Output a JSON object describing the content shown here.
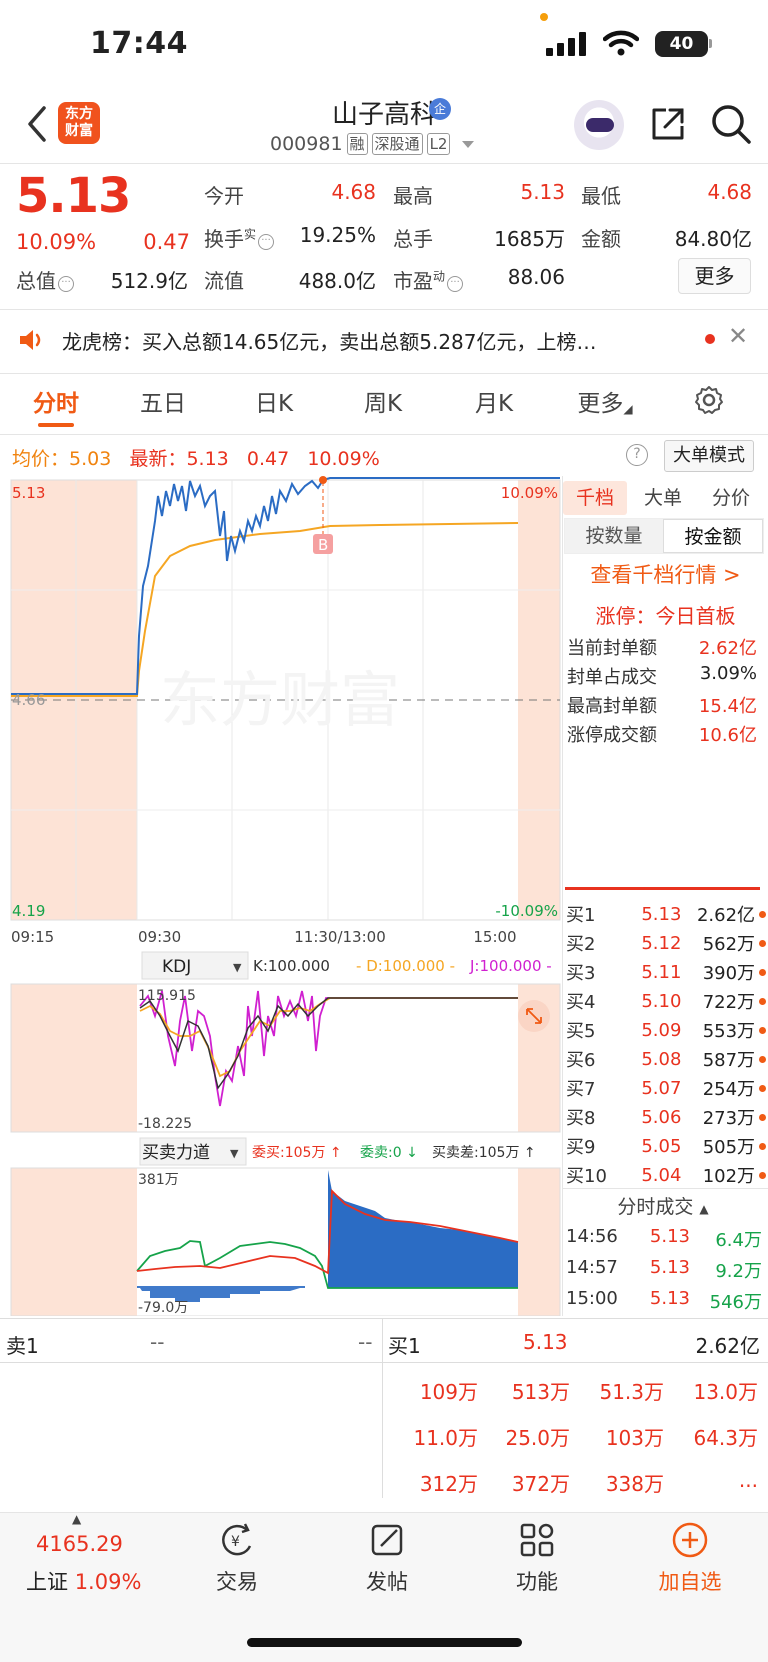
{
  "status": {
    "time": "17:44",
    "battery": "40"
  },
  "header": {
    "logo_text": "东方\n财富",
    "stock_name": "山子高科",
    "name_badge": "企",
    "code": "000981",
    "tags": [
      "融",
      "深股通",
      "L2"
    ]
  },
  "quote": {
    "price": "5.13",
    "pct": "10.09%",
    "change": "0.47",
    "fields": {
      "open_label": "今开",
      "open": "4.68",
      "high_label": "最高",
      "high": "5.13",
      "low_label": "最低",
      "low": "4.68",
      "turnover_label": "换手",
      "turnover_sup": "实",
      "turnover": "19.25%",
      "volume_label": "总手",
      "volume": "1685万",
      "amount_label": "金额",
      "amount": "84.80亿",
      "mktcap_label": "总值",
      "mktcap": "512.9亿",
      "float_label": "流值",
      "float": "488.0亿",
      "pe_label": "市盈",
      "pe_sup": "动",
      "pe": "88.06"
    },
    "more_label": "更多"
  },
  "dragon_tiger": {
    "text": "龙虎榜：买入总额14.65亿元，卖出总额5.287亿元，上榜…"
  },
  "period_tabs": [
    "分时",
    "五日",
    "日K",
    "周K",
    "月K",
    "更多"
  ],
  "info_line": {
    "avg_label": "均价：",
    "avg": "5.03",
    "latest_label": "最新：",
    "latest": "5.13",
    "change": "0.47",
    "pct": "10.09%",
    "big_order_mode": "大单模式"
  },
  "intraday": {
    "y_top": "5.13",
    "y_mid": "4.66",
    "y_bottom": "4.19",
    "pct_top": "10.09%",
    "pct_bottom": "-10.09%",
    "x_labels": [
      "09:15",
      "09:30",
      "11:30/13:00",
      "15:00"
    ],
    "watermark": "东方财富",
    "marker": "B"
  },
  "kdj": {
    "label": "KDJ",
    "k": "K:100.000",
    "d": "D:100.000",
    "j": "J:100.000",
    "max": "115.915",
    "min": "-18.225"
  },
  "force": {
    "label": "买卖力道",
    "buy": "委买:105万 ↑",
    "sell": "委卖:0 ↓",
    "diff": "买卖差:105万 ↑",
    "max": "381万",
    "min": "-79.0万"
  },
  "right_panel": {
    "tabs": [
      "千档",
      "大单",
      "分价"
    ],
    "sub_tabs": [
      "按数量",
      "按金额"
    ],
    "link": "查看千档行情 >",
    "limit_text": "涨停：今日首板",
    "stats": [
      {
        "label": "当前封单额",
        "value": "2.62亿"
      },
      {
        "label": "封单占成交",
        "value": "3.09%"
      },
      {
        "label": "最高封单额",
        "value": "15.4亿"
      },
      {
        "label": "涨停成交额",
        "value": "10.6亿"
      }
    ],
    "bids": [
      {
        "label": "买1",
        "price": "5.13",
        "vol": "2.62亿"
      },
      {
        "label": "买2",
        "price": "5.12",
        "vol": "562万"
      },
      {
        "label": "买3",
        "price": "5.11",
        "vol": "390万"
      },
      {
        "label": "买4",
        "price": "5.10",
        "vol": "722万"
      },
      {
        "label": "买5",
        "price": "5.09",
        "vol": "553万"
      },
      {
        "label": "买6",
        "price": "5.08",
        "vol": "587万"
      },
      {
        "label": "买7",
        "price": "5.07",
        "vol": "254万"
      },
      {
        "label": "买8",
        "price": "5.06",
        "vol": "273万"
      },
      {
        "label": "买9",
        "price": "5.05",
        "vol": "505万"
      },
      {
        "label": "买10",
        "price": "5.04",
        "vol": "102万"
      }
    ],
    "ticks_header": "分时成交",
    "ticks": [
      {
        "time": "14:56",
        "price": "5.13",
        "vol": "6.4万",
        "color": "#16a34a"
      },
      {
        "time": "14:57",
        "price": "5.13",
        "vol": "9.2万",
        "color": "#16a34a"
      },
      {
        "time": "15:00",
        "price": "5.13",
        "vol": "546万",
        "color": "#16a34a"
      }
    ]
  },
  "order_book": {
    "sell_label": "卖1",
    "sell_price": "--",
    "sell_vol": "--",
    "buy_label": "买1",
    "buy_price": "5.13",
    "buy_vol": "2.62亿",
    "queue": [
      "109万",
      "513万",
      "51.3万",
      "13.0万",
      "11.0万",
      "25.0万",
      "103万",
      "64.3万",
      "312万",
      "372万",
      "338万",
      "..."
    ]
  },
  "bottom_nav": {
    "index_value": "4165.29",
    "index_name": "上证",
    "index_pct": "1.09%",
    "items": [
      "交易",
      "发帖",
      "功能",
      "加自选"
    ]
  }
}
